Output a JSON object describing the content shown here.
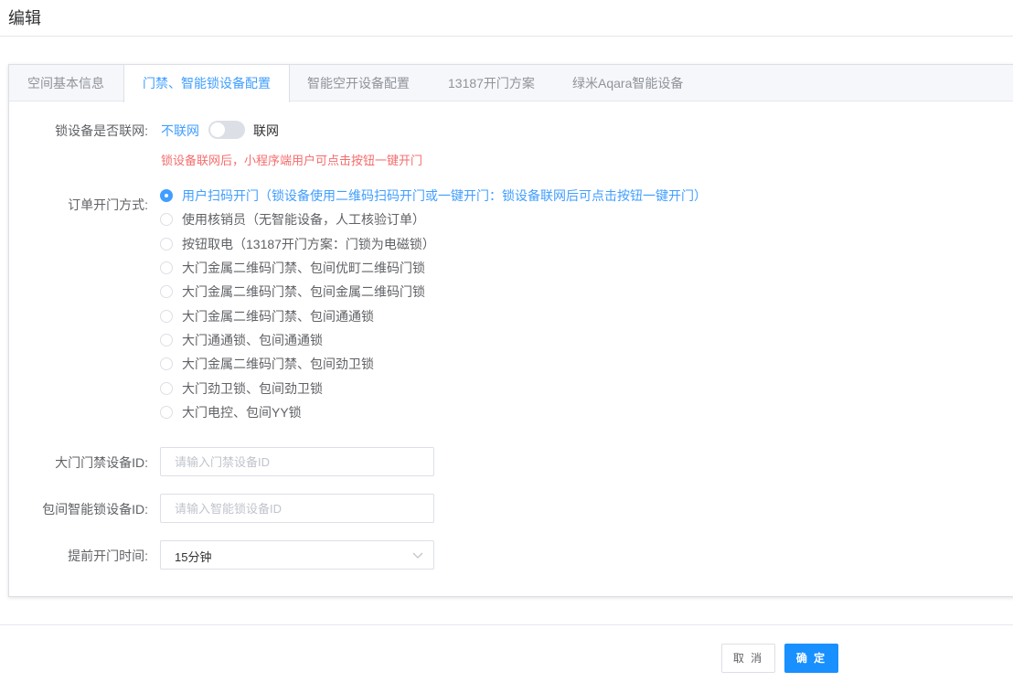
{
  "dialog": {
    "title": "编辑"
  },
  "tabs": [
    {
      "label": "空间基本信息",
      "active": false
    },
    {
      "label": "门禁、智能锁设备配置",
      "active": true
    },
    {
      "label": "智能空开设备配置",
      "active": false
    },
    {
      "label": "13187开门方案",
      "active": false
    },
    {
      "label": "绿米Aqara智能设备",
      "active": false
    }
  ],
  "form": {
    "network": {
      "label": "锁设备是否联网:",
      "off_text": "不联网",
      "on_text": "联网",
      "value": false,
      "hint": "锁设备联网后，小程序端用户可点击按钮一键开门"
    },
    "open_method": {
      "label": "订单开门方式:",
      "selected_index": 0,
      "options": [
        "用户扫码开门（锁设备使用二维码扫码开门或一键开门：锁设备联网后可点击按钮一键开门）",
        "使用核销员（无智能设备，人工核验订单）",
        "按钮取电（13187开门方案：门锁为电磁锁）",
        "大门金属二维码门禁、包间优町二维码门锁",
        "大门金属二维码门禁、包间金属二维码门锁",
        "大门金属二维码门禁、包间通通锁",
        "大门通通锁、包间通通锁",
        "大门金属二维码门禁、包间劲卫锁",
        "大门劲卫锁、包间劲卫锁",
        "大门电控、包间YY锁"
      ]
    },
    "gate_id": {
      "label": "大门门禁设备ID:",
      "value": "",
      "placeholder": "请输入门禁设备ID"
    },
    "room_lock_id": {
      "label": "包间智能锁设备ID:",
      "value": "",
      "placeholder": "请输入智能锁设备ID"
    },
    "advance_time": {
      "label": "提前开门时间:",
      "value": "15分钟",
      "icon": "chevron-down-icon"
    }
  },
  "footer": {
    "cancel_label": "取 消",
    "ok_label": "确 定"
  },
  "colors": {
    "accent": "#409eff",
    "primary_button": "#1890ff",
    "hint": "#f56c6c"
  }
}
